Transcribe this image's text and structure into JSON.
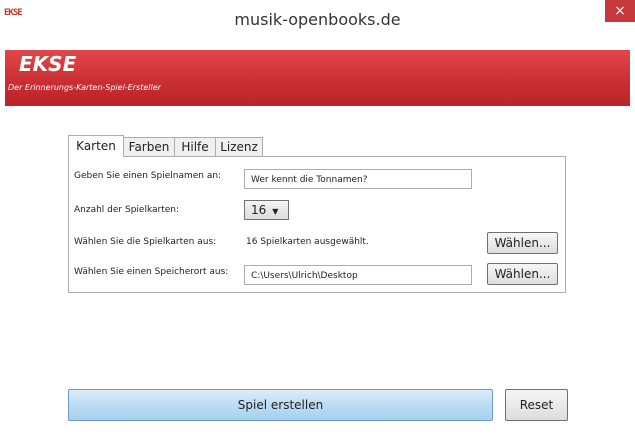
{
  "window": {
    "app_icon_text": "EKSE",
    "title": "musik-openbooks.de",
    "close_label": "×"
  },
  "banner": {
    "title": "EKSE",
    "subtitle": "Der Erinnerungs-Karten-Spiel-Ersteller"
  },
  "tabs": [
    {
      "label": "Karten",
      "active": true
    },
    {
      "label": "Farben",
      "active": false
    },
    {
      "label": "Hilfe",
      "active": false
    },
    {
      "label": "Lizenz",
      "active": false
    }
  ],
  "form": {
    "game_name_label": "Geben Sie einen Spielnamen an:",
    "game_name_value": "Wer kennt die Tonnamen?",
    "card_count_label": "Anzahl der Spielkarten:",
    "card_count_value": "16",
    "select_cards_label": "Wählen Sie die Spielkarten aus:",
    "select_cards_status": "16 Spielkarten ausgewählt.",
    "select_cards_button": "Wählen...",
    "save_location_label": "Wählen Sie einen Speicherort aus:",
    "save_location_value": "C:\\Users\\Ulrich\\Desktop",
    "save_location_button": "Wählen..."
  },
  "actions": {
    "create_label": "Spiel erstellen",
    "reset_label": "Reset"
  },
  "colors": {
    "banner": "#c92d31",
    "close_button": "#c7383a",
    "create_button": "#bcdcf3"
  }
}
